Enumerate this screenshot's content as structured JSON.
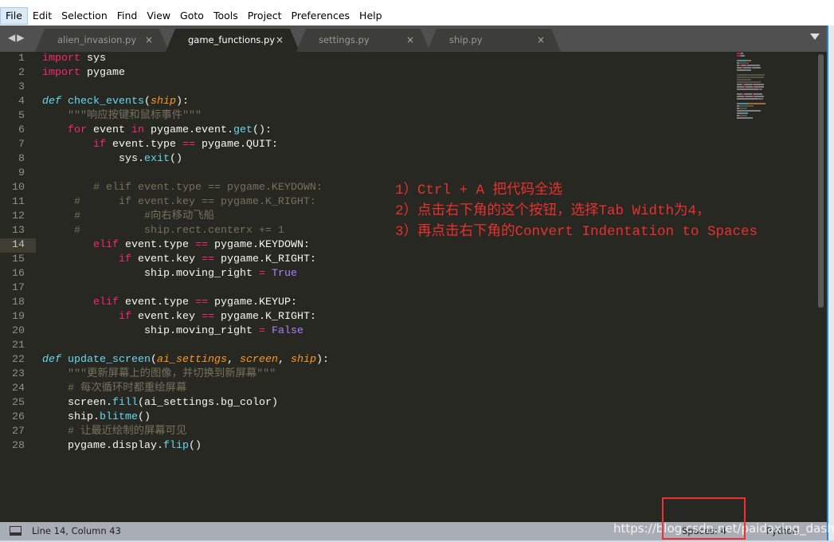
{
  "menu": [
    "File",
    "Edit",
    "Selection",
    "Find",
    "View",
    "Goto",
    "Tools",
    "Project",
    "Preferences",
    "Help"
  ],
  "tabs": [
    {
      "label": "alien_invasion.py",
      "active": false
    },
    {
      "label": "game_functions.py",
      "active": true
    },
    {
      "label": "settings.py",
      "active": false
    },
    {
      "label": "ship.py",
      "active": false
    }
  ],
  "tab_close": "×",
  "nav_arrows": "◀▶",
  "current_line": 14,
  "code": [
    [
      [
        "k",
        "import"
      ],
      [
        "t",
        " sys"
      ]
    ],
    [
      [
        "k",
        "import"
      ],
      [
        "t",
        " pygame"
      ]
    ],
    [],
    [
      [
        "d",
        "def"
      ],
      [
        "t",
        " "
      ],
      [
        "f",
        "check_events"
      ],
      [
        "t",
        "("
      ],
      [
        "p",
        "ship"
      ],
      [
        "t",
        "):"
      ]
    ],
    [
      [
        "t",
        "    "
      ],
      [
        "c",
        "\"\"\"响应按键和鼠标事件\"\"\""
      ]
    ],
    [
      [
        "t",
        "    "
      ],
      [
        "k",
        "for"
      ],
      [
        "t",
        " event "
      ],
      [
        "k",
        "in"
      ],
      [
        "t",
        " pygame.event."
      ],
      [
        "f",
        "get"
      ],
      [
        "t",
        "():"
      ]
    ],
    [
      [
        "t",
        "        "
      ],
      [
        "k",
        "if"
      ],
      [
        "t",
        " event.type "
      ],
      [
        "k",
        "=="
      ],
      [
        "t",
        " pygame.QUIT:"
      ]
    ],
    [
      [
        "t",
        "            sys."
      ],
      [
        "f",
        "exit"
      ],
      [
        "t",
        "()"
      ]
    ],
    [],
    [
      [
        "c",
        "        # elif event.type == pygame.KEYDOWN:"
      ]
    ],
    [
      [
        "c",
        "     #      if event.key == pygame.K_RIGHT:"
      ]
    ],
    [
      [
        "c",
        "     #          #向右移动飞船"
      ]
    ],
    [
      [
        "c",
        "     #          ship.rect.centerx += 1"
      ]
    ],
    [
      [
        "t",
        "        "
      ],
      [
        "k",
        "elif"
      ],
      [
        "t",
        " event.type "
      ],
      [
        "k",
        "=="
      ],
      [
        "t",
        " pygame.KEYDOWN:"
      ]
    ],
    [
      [
        "t",
        "            "
      ],
      [
        "k",
        "if"
      ],
      [
        "t",
        " event.key "
      ],
      [
        "k",
        "=="
      ],
      [
        "t",
        " pygame.K_RIGHT:"
      ]
    ],
    [
      [
        "t",
        "                ship.moving_right "
      ],
      [
        "k",
        "="
      ],
      [
        "t",
        " "
      ],
      [
        "n",
        "True"
      ]
    ],
    [],
    [
      [
        "t",
        "        "
      ],
      [
        "k",
        "elif"
      ],
      [
        "t",
        " event.type "
      ],
      [
        "k",
        "=="
      ],
      [
        "t",
        " pygame.KEYUP:"
      ]
    ],
    [
      [
        "t",
        "            "
      ],
      [
        "k",
        "if"
      ],
      [
        "t",
        " event.key "
      ],
      [
        "k",
        "=="
      ],
      [
        "t",
        " pygame.K_RIGHT:"
      ]
    ],
    [
      [
        "t",
        "                ship.moving_right "
      ],
      [
        "k",
        "="
      ],
      [
        "t",
        " "
      ],
      [
        "n",
        "False"
      ]
    ],
    [],
    [
      [
        "d",
        "def"
      ],
      [
        "t",
        " "
      ],
      [
        "f",
        "update_screen"
      ],
      [
        "t",
        "("
      ],
      [
        "p",
        "ai_settings"
      ],
      [
        "t",
        ", "
      ],
      [
        "p",
        "screen"
      ],
      [
        "t",
        ", "
      ],
      [
        "p",
        "ship"
      ],
      [
        "t",
        "):"
      ]
    ],
    [
      [
        "t",
        "    "
      ],
      [
        "c",
        "\"\"\"更新屏幕上的图像，并切换到新屏幕\"\"\""
      ]
    ],
    [
      [
        "t",
        "    "
      ],
      [
        "c",
        "# 每次循环时都重绘屏幕"
      ]
    ],
    [
      [
        "t",
        "    screen."
      ],
      [
        "f",
        "fill"
      ],
      [
        "t",
        "(ai_settings.bg_color)"
      ]
    ],
    [
      [
        "t",
        "    ship."
      ],
      [
        "f",
        "blitme"
      ],
      [
        "t",
        "()"
      ]
    ],
    [
      [
        "t",
        "    "
      ],
      [
        "c",
        "# 让最近绘制的屏幕可见"
      ]
    ],
    [
      [
        "t",
        "    pygame.display."
      ],
      [
        "f",
        "flip"
      ],
      [
        "t",
        "()"
      ]
    ]
  ],
  "annotation": {
    "line1": "1）Ctrl + A 把代码全选",
    "line2": "2）点击右下角的这个按钮，选择Tab Width为4，",
    "line3": "3）再点击右下角的Convert Indentation to Spaces"
  },
  "status": {
    "position": "Line 14, Column 43",
    "indentation": "Spaces: 4",
    "syntax": "Python"
  },
  "watermark": "https://blog.csdn.net/paidaxing_dashu",
  "colors": {
    "background": "#272822",
    "keyword": "#f92672",
    "function": "#66d9ef",
    "parameter": "#fd971f",
    "comment": "#75715e",
    "constant": "#ae81ff",
    "annotation": "#e8302f",
    "highlight_box": "#f03030"
  }
}
